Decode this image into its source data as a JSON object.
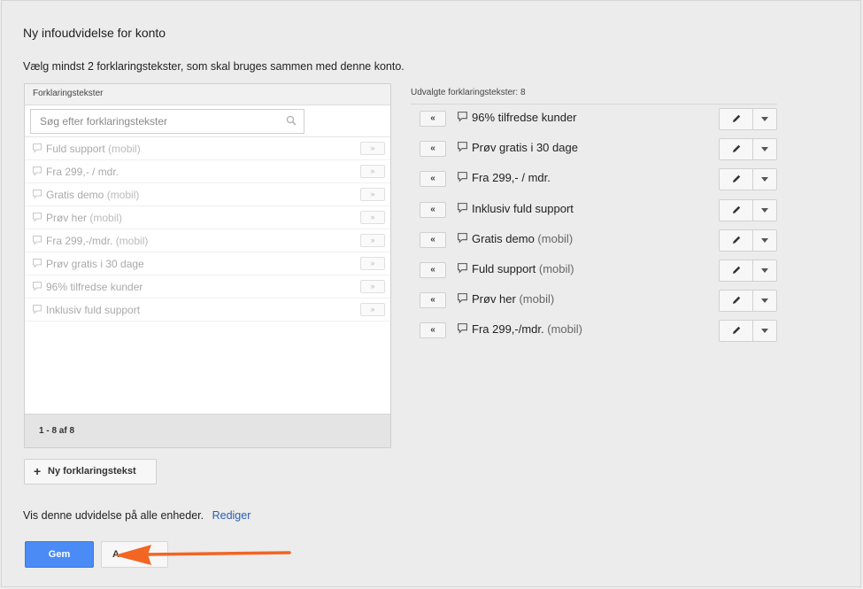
{
  "title": "Ny infoudvidelse for konto",
  "instruction": "Vælg mindst 2 forklaringstekster, som skal bruges sammen med denne konto.",
  "available": {
    "header": "Forklaringstekster",
    "search_placeholder": "Søg efter forklaringstekster",
    "add_label": "»",
    "items": [
      {
        "text": "Fuld support",
        "suffix": " (mobil)"
      },
      {
        "text": "Fra 299,- / mdr.",
        "suffix": ""
      },
      {
        "text": "Gratis demo",
        "suffix": " (mobil)"
      },
      {
        "text": "Prøv her",
        "suffix": " (mobil)"
      },
      {
        "text": "Fra 299,-/mdr.",
        "suffix": " (mobil)"
      },
      {
        "text": "Prøv gratis i 30 dage",
        "suffix": ""
      },
      {
        "text": "96% tilfredse kunder",
        "suffix": ""
      },
      {
        "text": "Inklusiv fuld support",
        "suffix": ""
      }
    ],
    "pagination": "1 - 8 af 8"
  },
  "selected": {
    "header": "Udvalgte forklaringstekster: 8",
    "remove_label": "«",
    "items": [
      {
        "text": "96% tilfredse kunder",
        "suffix": ""
      },
      {
        "text": "Prøv gratis i 30 dage",
        "suffix": ""
      },
      {
        "text": "Fra 299,- / mdr.",
        "suffix": ""
      },
      {
        "text": "Inklusiv fuld support",
        "suffix": ""
      },
      {
        "text": "Gratis demo",
        "suffix": " (mobil)"
      },
      {
        "text": "Fuld support",
        "suffix": " (mobil)"
      },
      {
        "text": "Prøv her",
        "suffix": " (mobil)"
      },
      {
        "text": "Fra 299,-/mdr.",
        "suffix": " (mobil)"
      }
    ]
  },
  "new_button_label": "Ny forklaringstekst",
  "devices_text": "Vis denne udvidelse på alle enheder.",
  "devices_edit_link": "Rediger",
  "save_label": "Gem",
  "cancel_label": "A",
  "colors": {
    "accent": "#4a8bf5",
    "link": "#2a5db0",
    "annotation_arrow": "#f26522"
  }
}
